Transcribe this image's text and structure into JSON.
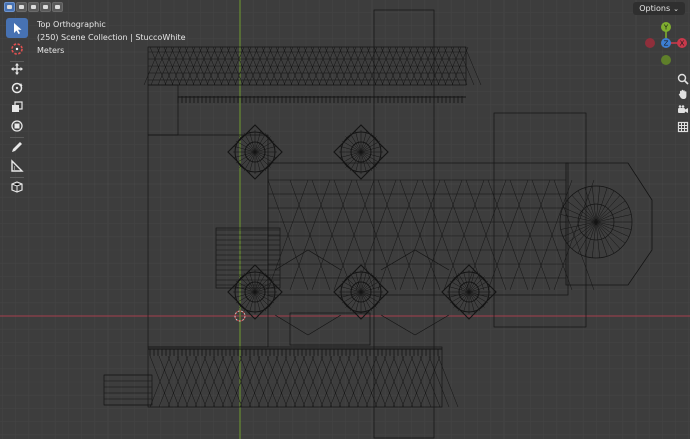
{
  "viewport": {
    "view_name": "Top Orthographic",
    "collection_info": "(250) Scene Collection | StuccoWhite",
    "units": "Meters",
    "options_label": "Options",
    "options_caret": "⌄"
  },
  "gizmo": {
    "y_label": "Y",
    "z_label": "Z",
    "x_label": "X",
    "colors": {
      "x": "#c9394b",
      "y": "#7fae2f",
      "z": "#3d7fd4"
    }
  },
  "toolbar": {
    "tools": [
      "select-box",
      "cursor",
      "move",
      "rotate",
      "scale",
      "transform",
      "annotate",
      "measure",
      "add-cube"
    ],
    "active_tool": "select-box"
  },
  "nav_buttons": [
    "zoom",
    "pan",
    "camera",
    "grid-toggle"
  ],
  "colors": {
    "background": "#3d3d3d",
    "grid_minor": "#454545",
    "grid_major": "#4c4c4c",
    "x_axis": "#a53f4d",
    "y_axis": "#6f9a2e",
    "wire": "#141414",
    "accent": "#4772b3"
  }
}
